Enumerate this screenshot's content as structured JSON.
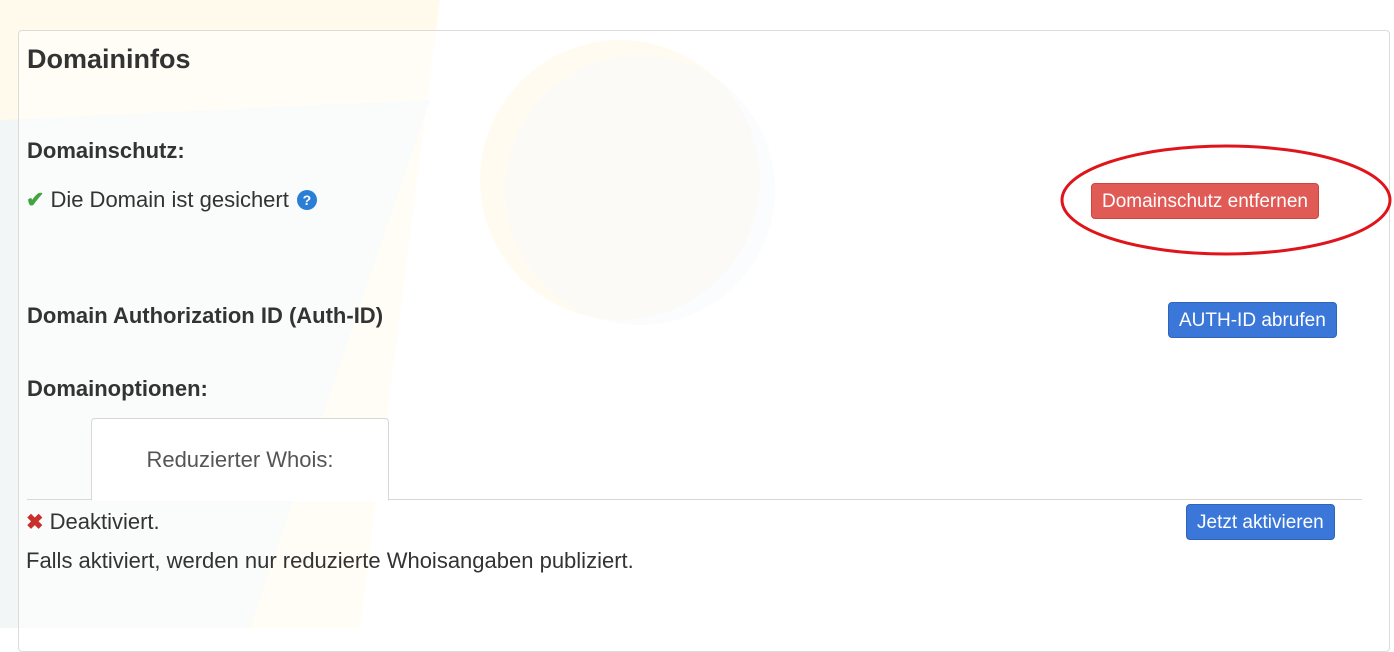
{
  "panel": {
    "title": "Domaininfos"
  },
  "domain_protection": {
    "heading": "Domainschutz:",
    "status_text": "Die Domain ist gesichert",
    "status_icon": "check-icon",
    "help_icon": "help-icon",
    "remove_button": "Domainschutz entfernen"
  },
  "auth_id": {
    "heading": "Domain Authorization ID (Auth-ID)",
    "fetch_button": "AUTH-ID abrufen"
  },
  "domain_options": {
    "heading": "Domainoptionen:",
    "tab_label": "Reduzierter Whois:",
    "status_icon": "x-icon",
    "status_text": "Deaktiviert.",
    "activate_button": "Jetzt aktivieren",
    "info_text": "Falls aktiviert, werden nur reduzierte Whoisangaben publiziert."
  },
  "colors": {
    "danger": "#e05a56",
    "primary": "#3a77d9",
    "success": "#3fa53f",
    "annotation": "#e0151c"
  }
}
